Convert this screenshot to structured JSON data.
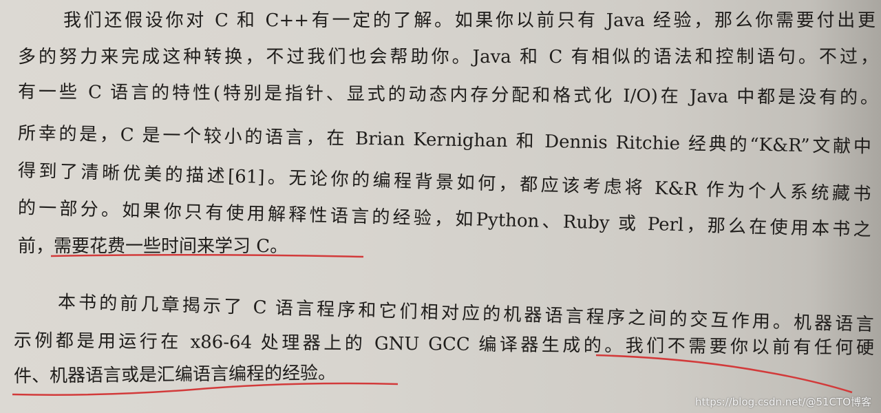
{
  "paragraphs": [
    {
      "lines": [
        "我们还假设你对 C 和 C++有一定的了解。如果你以前只有 Java 经验，那么你需要付出更",
        "多的努力来完成这种转换，不过我们也会帮助你。Java 和 C 有相似的语法和控制语句。不过，",
        "有一些 C 语言的特性(特别是指针、显式的动态内存分配和格式化 I/O)在 Java 中都是没有的。",
        "所幸的是，C 是一个较小的语言，在 Brian Kernighan 和 Dennis Ritchie 经典的“K&R”文献中",
        "得到了清晰优美的描述[61]。无论你的编程背景如何，都应该考虑将 K&R 作为个人系统藏书",
        "的一部分。如果你只有使用解释性语言的经验，如Python、Ruby 或 Perl，那么在使用本书之",
        "前，需要花费一些时间来学习 C。"
      ]
    },
    {
      "lines": [
        "本书的前几章揭示了 C 语言程序和它们相对应的机器语言程序之间的交互作用。机器语言",
        "示例都是用运行在 x86-64 处理器上的 GNU GCC 编译器生成的。我们不需要你以前有任何硬",
        "件、机器语言或是汇编语言编程的经验。"
      ]
    }
  ],
  "watermark": "https://blog.csdn.net/@51CTO博客",
  "colors": {
    "underline": "#d23a3a",
    "text": "#1f1d1b"
  }
}
